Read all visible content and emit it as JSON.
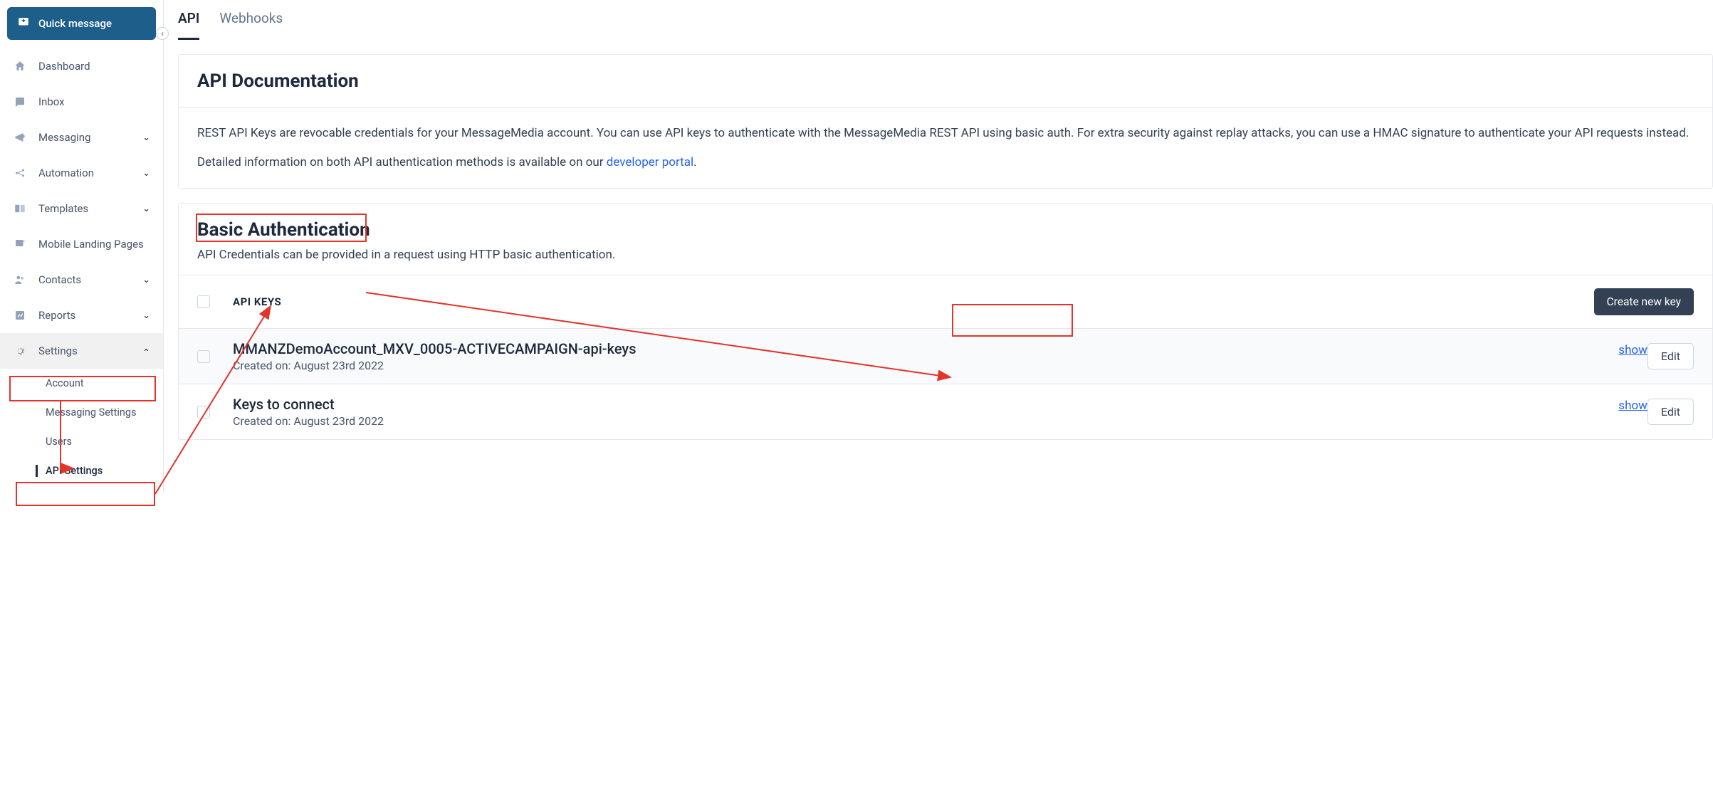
{
  "sidebar": {
    "quick_message": "Quick message",
    "items": {
      "dashboard": "Dashboard",
      "inbox": "Inbox",
      "messaging": "Messaging",
      "automation": "Automation",
      "templates": "Templates",
      "mlp": "Mobile Landing Pages",
      "contacts": "Contacts",
      "reports": "Reports",
      "settings": "Settings"
    },
    "subnav": {
      "account": "Account",
      "messaging_settings": "Messaging Settings",
      "users": "Users",
      "api_settings": "API Settings"
    }
  },
  "tabs": {
    "api": "API",
    "webhooks": "Webhooks"
  },
  "doc": {
    "title": "API Documentation",
    "p1a": "REST API Keys are revocable credentials for your MessageMedia account. You can use API keys to authenticate with the MessageMedia REST API using basic auth. For extra security against replay attacks, you can use a HMAC signature to authenticate your API requests instead.",
    "p2a": "Detailed information on both API authentication methods is available on our ",
    "p2link": "developer portal",
    "p2b": "."
  },
  "auth": {
    "title": "Basic Authentication",
    "subtitle": "API Credentials can be provided in a request using HTTP basic authentication.",
    "col_header": "API KEYS",
    "create_btn": "Create new key",
    "edit_btn": "Edit",
    "show_link": "show",
    "keys": [
      {
        "name": "MMANZDemoAccount_MXV_0005-ACTIVECAMPAIGN-api-keys",
        "created": "Created on: August 23rd 2022"
      },
      {
        "name": "Keys to connect",
        "created": "Created on: August 23rd 2022"
      }
    ]
  }
}
